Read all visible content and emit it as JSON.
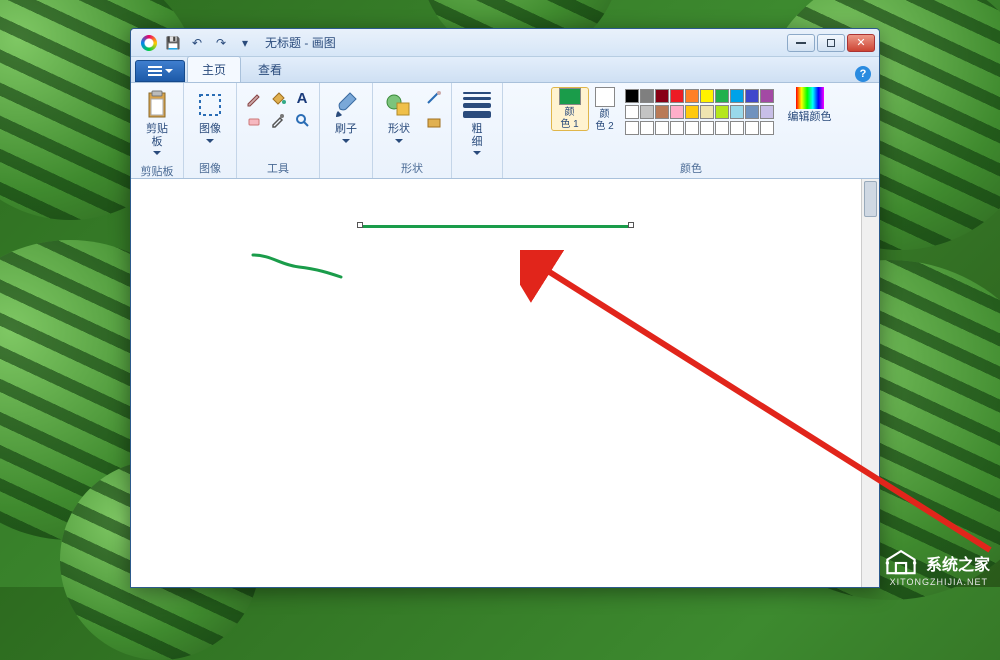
{
  "window": {
    "doc_title": "无标题",
    "app_name": "画图",
    "title_sep": " - "
  },
  "qat": {
    "save": "💾",
    "undo": "↶",
    "redo": "↷"
  },
  "win_controls": {
    "minimize": "minimize",
    "maximize": "maximize",
    "close": "✕"
  },
  "tabs": {
    "home": "主页",
    "view": "查看",
    "help": "?"
  },
  "ribbon": {
    "clipboard": {
      "label": "剪贴板",
      "btn": "剪贴\n板"
    },
    "image": {
      "label": "图像",
      "btn": "图像"
    },
    "tools": {
      "label": "工具",
      "pencil": "pencil-icon",
      "fill": "fill-icon",
      "text": "A",
      "eraser": "eraser-icon",
      "picker": "picker-icon",
      "zoom": "zoom-icon"
    },
    "brushes": {
      "label": "刷子",
      "btn": "刷子"
    },
    "shapes": {
      "label": "形状",
      "btn": "形状"
    },
    "size": {
      "btn": "粗\n细"
    },
    "colors": {
      "label": "颜色",
      "color1": "颜\n色 1",
      "color2": "颜\n色 2",
      "color1_hex": "#1a9c4a",
      "color2_hex": "#ffffff",
      "edit": "编辑颜色",
      "palette_row1": [
        "#000000",
        "#7f7f7f",
        "#880015",
        "#ed1c24",
        "#ff7f27",
        "#fff200",
        "#22b14c",
        "#00a2e8",
        "#3f48cc",
        "#a349a4"
      ],
      "palette_row2": [
        "#ffffff",
        "#c3c3c3",
        "#b97a57",
        "#ffaec9",
        "#ffc90e",
        "#efe4b0",
        "#b5e61d",
        "#99d9ea",
        "#7092be",
        "#c8bfe7"
      ]
    }
  },
  "watermark": {
    "text": "系统之家",
    "url": "XITONGZHIJIA.NET"
  }
}
